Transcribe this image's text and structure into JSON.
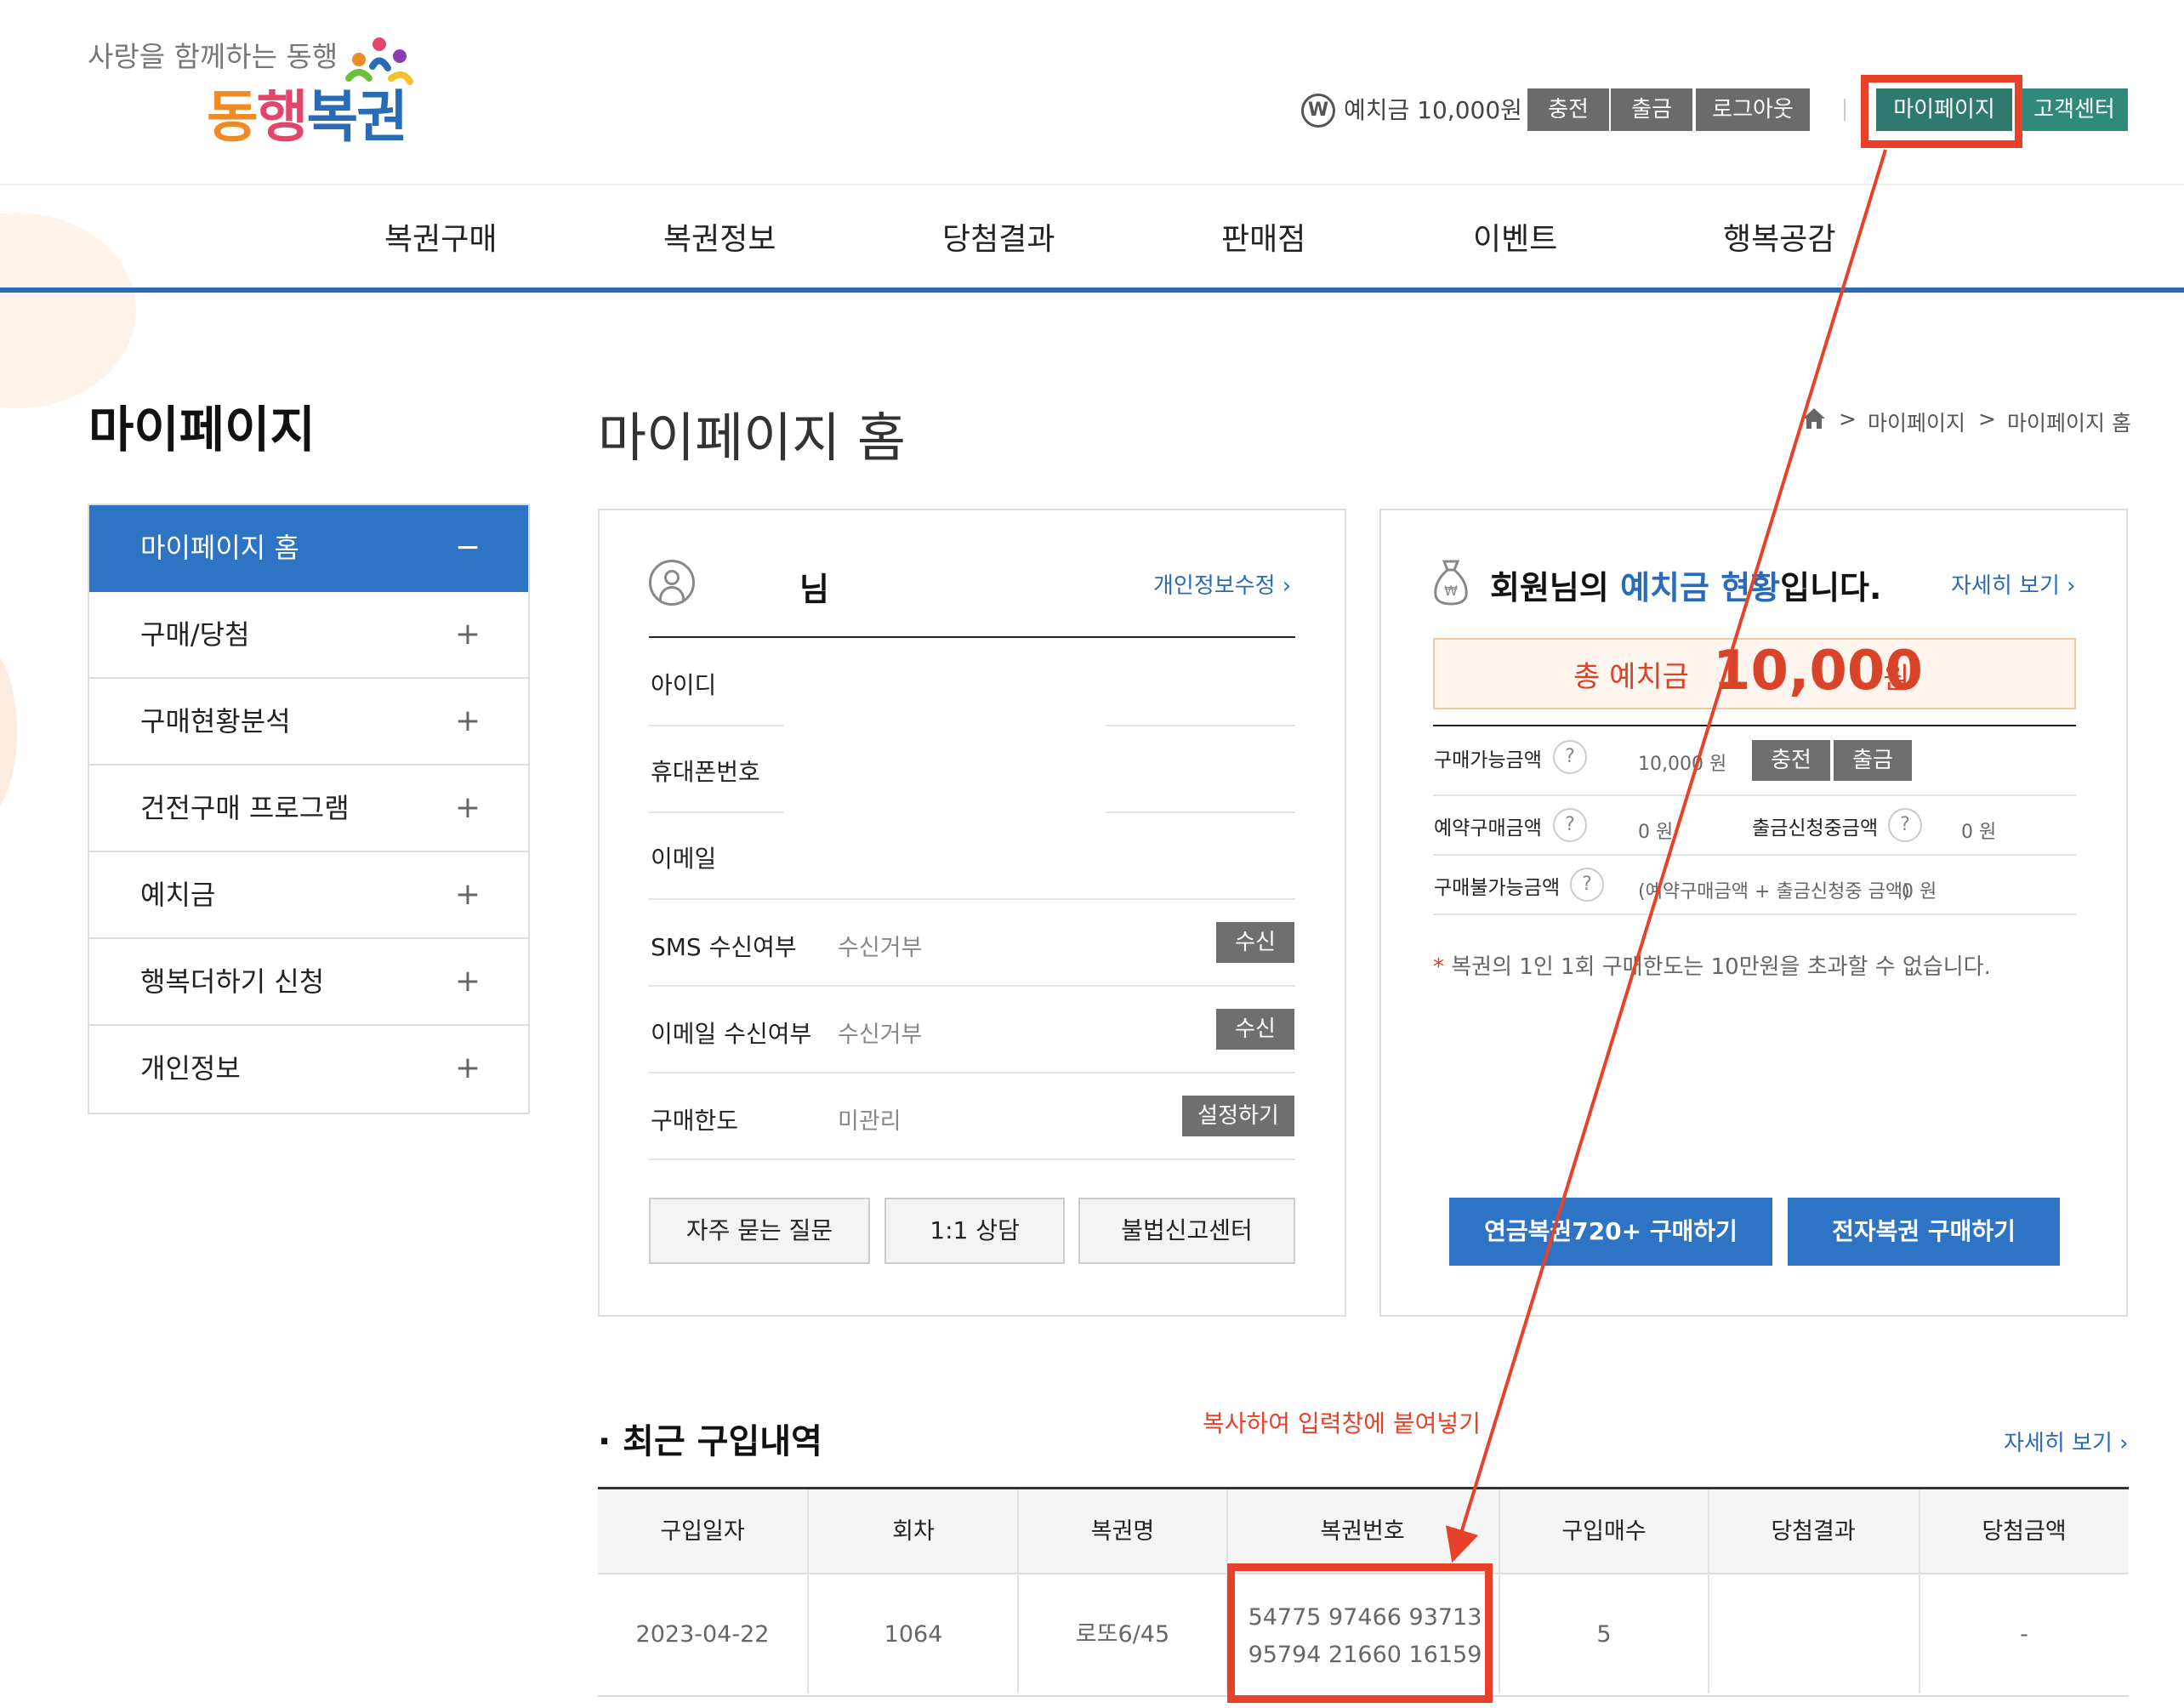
{
  "brand": {
    "slogan": "사랑을 함께하는 동행",
    "logo_part1": "동",
    "logo_part2": "행",
    "logo_part3": "복권"
  },
  "topbar": {
    "deposit_label": "예치금 10,000원",
    "won_symbol": "W",
    "charge": "충전",
    "withdraw": "출금",
    "logout": "로그아웃",
    "mypage": "마이페이지",
    "customer_center": "고객센터"
  },
  "gnb": [
    "복권구매",
    "복권정보",
    "당첨결과",
    "판매점",
    "이벤트",
    "행복공감"
  ],
  "sidebar": {
    "title": "마이페이지",
    "items": [
      {
        "label": "마이페이지 홈",
        "sign": "−"
      },
      {
        "label": "구매/당첨",
        "sign": "+"
      },
      {
        "label": "구매현황분석",
        "sign": "+"
      },
      {
        "label": "건전구매 프로그램",
        "sign": "+"
      },
      {
        "label": "예치금",
        "sign": "+"
      },
      {
        "label": "행복더하기 신청",
        "sign": "+"
      },
      {
        "label": "개인정보",
        "sign": "+"
      }
    ]
  },
  "page": {
    "title": "마이페이지 홈",
    "breadcrumb": [
      "마이페이지",
      "마이페이지 홈"
    ],
    "sep": ">"
  },
  "profile": {
    "name_suffix": "님",
    "edit_link": "개인정보수정 ›",
    "rows": {
      "id": "아이디",
      "phone": "휴대폰번호",
      "email": "이메일",
      "sms": "SMS 수신여부",
      "sms_value": "수신거부",
      "sms_btn": "수신",
      "email_sub": "이메일 수신여부",
      "email_sub_value": "수신거부",
      "email_sub_btn": "수신",
      "limit": "구매한도",
      "limit_value": "미관리",
      "limit_btn": "설정하기"
    },
    "buttons": [
      "자주 묻는 질문",
      "1:1 상담",
      "불법신고센터"
    ]
  },
  "deposit": {
    "title_pre": "회원님의 ",
    "title_blue": "예치금 현황",
    "title_post": "입니다.",
    "more": "자세히 보기 ›",
    "total_label": "총 예치금",
    "total_value": "10,000",
    "total_unit": "원",
    "available_label": "구매가능금액",
    "available_value": "10,000 원",
    "charge_btn": "충전",
    "withdraw_btn": "출금",
    "reserved_label": "예약구매금액",
    "reserved_value": "0 원",
    "withdraw_pending_label": "출금신청중금액",
    "withdraw_pending_value": "0 원",
    "unavailable_label": "구매불가능금액",
    "unavailable_note": "(예약구매금액 + 출금신청중 금액)",
    "unavailable_value": "0 원",
    "qmark": "?",
    "notice_star": "*",
    "notice": " 복권의 1인 1회 구매한도는 10만원을 초과할 수 없습니다.",
    "btn_pension": "연금복권720+ 구매하기",
    "btn_electronic": "전자복권 구매하기"
  },
  "recent": {
    "bullet": "·",
    "title": "최근 구입내역",
    "more": "자세히 보기 ›",
    "annotation": "복사하여 입력창에 붙여넣기",
    "headers": [
      "구입일자",
      "회차",
      "복권명",
      "복권번호",
      "구입매수",
      "당첨결과",
      "당첨금액"
    ],
    "rows": [
      {
        "date": "2023-04-22",
        "round": "1064",
        "name": "로또6/45",
        "number_line1": "54775 97466 93713",
        "number_line2": "95794 21660 16159",
        "count": "5",
        "result": "",
        "prize": "-"
      }
    ]
  },
  "colors": {
    "primary_blue": "#2e74c4",
    "highlight_red": "#e8412a",
    "mypage_green": "#2f7a6f",
    "deposit_red": "#d9432a"
  }
}
